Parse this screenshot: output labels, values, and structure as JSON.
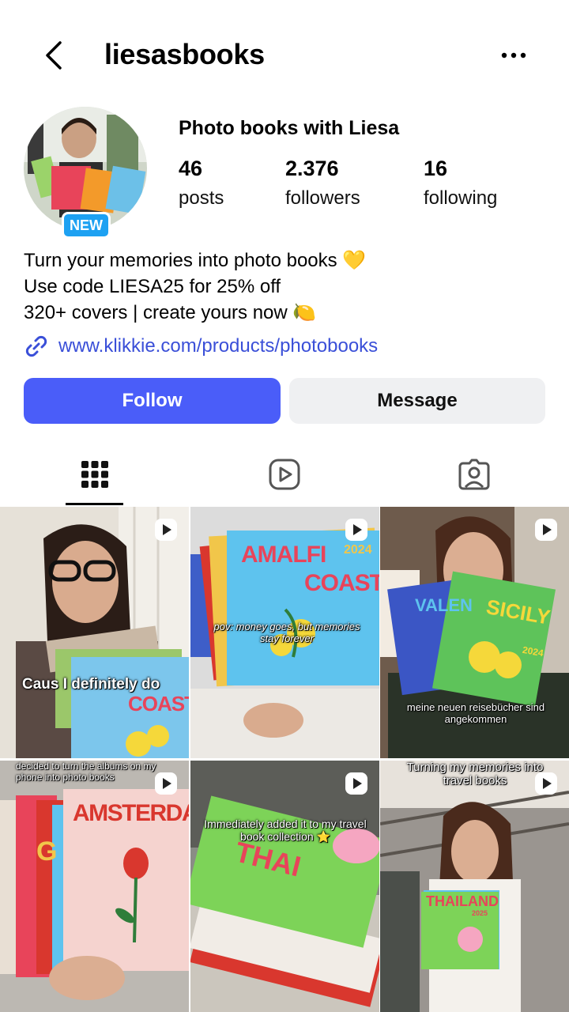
{
  "header": {
    "username": "liesasbooks",
    "back_icon": "chevron-left-icon",
    "more_icon": "more-horizontal-icon"
  },
  "profile": {
    "display_name": "Photo books with Liesa",
    "new_badge": "NEW",
    "stats": [
      {
        "value": "46",
        "label": "posts"
      },
      {
        "value": "2.376",
        "label": "followers"
      },
      {
        "value": "16",
        "label": "following"
      }
    ],
    "bio": [
      "Turn your memories into photo books 💛",
      "Use code LIESA25 for 25% off",
      "320+ covers | create yours now 🍋"
    ],
    "link": "www.klikkie.com/products/photobooks"
  },
  "actions": {
    "follow_label": "Follow",
    "message_label": "Message"
  },
  "tabs": [
    {
      "name": "grid-icon",
      "active": true
    },
    {
      "name": "reels-icon",
      "active": false
    },
    {
      "name": "tagged-icon",
      "active": false
    }
  ],
  "posts": [
    {
      "caption": "Caus I definitely do",
      "cover_text": [
        "COAST"
      ]
    },
    {
      "caption": "pov: money goes, but memories stay forever",
      "cover_text": [
        "AMALFI",
        "COAST",
        "2024"
      ]
    },
    {
      "caption": "meine neuen reisebücher sind angekommen",
      "cover_text": [
        "VALEN",
        "SICILY",
        "2024"
      ]
    },
    {
      "caption": "decided to turn the albums on my phone into photo books",
      "cover_text": [
        "AMSTERDA",
        "G"
      ]
    },
    {
      "caption": "Immediately added it to my travel book collection ⭐",
      "cover_text": [
        "THAI"
      ]
    },
    {
      "caption": "Turning my memories into travel books",
      "cover_text": [
        "THAILAND",
        "2025"
      ]
    }
  ],
  "colors": {
    "accent": "#4a5df9",
    "link": "#3a4fd8",
    "badge": "#1da1f2",
    "secondary_button": "#eff0f2"
  }
}
